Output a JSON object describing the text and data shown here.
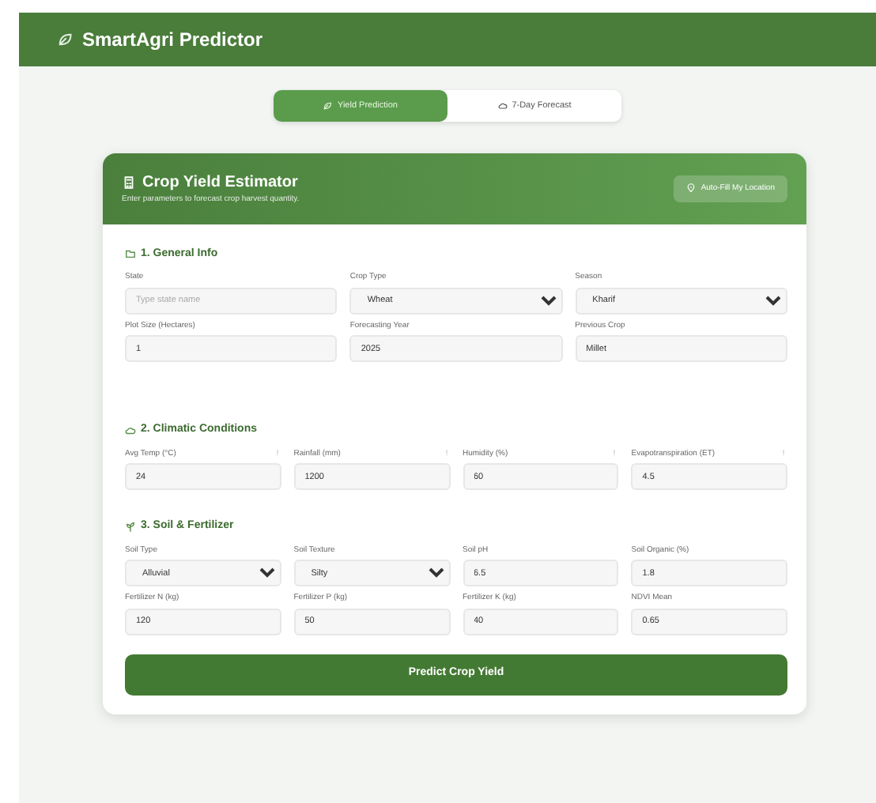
{
  "app_title": "SmartAgri Predictor",
  "tabs": [
    {
      "label": "Yield Prediction",
      "selected": true
    },
    {
      "label": "7-Day Forecast",
      "selected": false
    }
  ],
  "card": {
    "title": "Crop Yield Estimator",
    "subtitle": "Enter parameters to forecast crop harvest quantity.",
    "action_button": "Auto-Fill My Location"
  },
  "sections": [
    {
      "title": "1. General Info",
      "fields": [
        {
          "kind": "text",
          "label": "State",
          "placeholder": "Type state name"
        },
        {
          "kind": "select",
          "label": "Crop Type",
          "value": "Wheat"
        },
        {
          "kind": "select",
          "label": "Season",
          "value": "Kharif"
        },
        {
          "kind": "text",
          "label": "Plot Size (Hectares)",
          "value": "1"
        },
        {
          "kind": "text",
          "label": "Forecasting Year",
          "value": "2025"
        },
        {
          "kind": "text",
          "label": "Previous Crop",
          "value": "Millet"
        }
      ]
    },
    {
      "title": "2. Climatic Conditions",
      "fields": [
        {
          "kind": "text",
          "label": "Avg Temp (°C)",
          "value": "24"
        },
        {
          "kind": "text",
          "label": "Rainfall (mm)",
          "value": "1200"
        },
        {
          "kind": "text",
          "label": "Humidity (%)",
          "value": "60"
        },
        {
          "kind": "text",
          "label": "Evapotranspiration (ET)",
          "value": "4.5"
        }
      ]
    },
    {
      "title": "3. Soil & Fertilizer",
      "fields": [
        {
          "kind": "select",
          "label": "Soil Type",
          "value": "Alluvial"
        },
        {
          "kind": "select",
          "label": "Soil Texture",
          "value": "Silty"
        },
        {
          "kind": "text",
          "label": "Soil pH",
          "value": "6.5"
        },
        {
          "kind": "text",
          "label": "Soil Organic (%)",
          "value": "1.8"
        },
        {
          "kind": "text",
          "label": "Fertilizer N (kg)",
          "value": "120"
        },
        {
          "kind": "text",
          "label": "Fertilizer P (kg)",
          "value": "50"
        },
        {
          "kind": "text",
          "label": "Fertilizer K (kg)",
          "value": "40"
        },
        {
          "kind": "text",
          "label": "NDVI Mean",
          "value": "0.65"
        }
      ]
    }
  ],
  "submit_button": "Predict Crop Yield"
}
